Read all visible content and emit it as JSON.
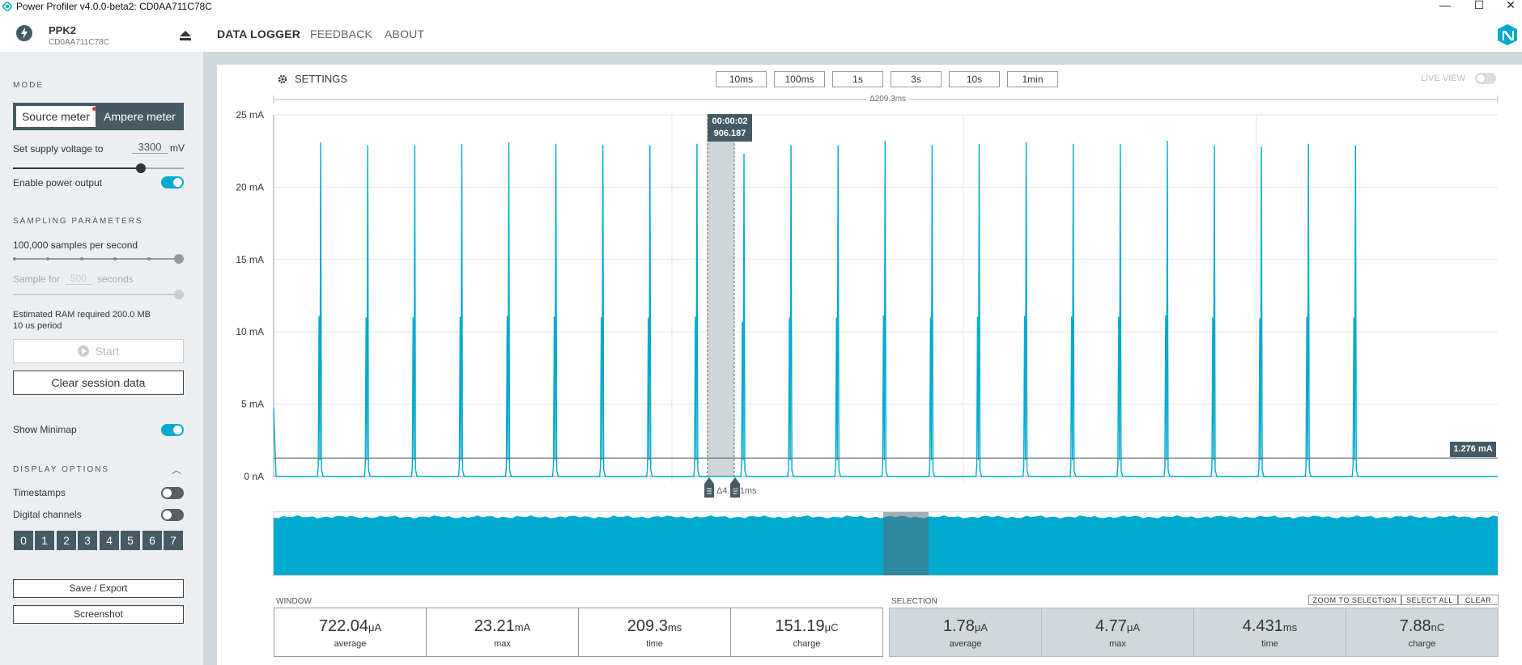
{
  "window": {
    "title": "Power Profiler v4.0.0-beta2: CD0AA711C78C"
  },
  "device": {
    "name": "PPK2",
    "serial": "CD0AA711C78C"
  },
  "nav": {
    "data_logger": "DATA LOGGER",
    "feedback": "FEEDBACK",
    "about": "ABOUT"
  },
  "sidebar": {
    "mode_title": "MODE",
    "source_meter": "Source meter",
    "ampere_meter": "Ampere meter",
    "supply_label": "Set supply voltage to",
    "supply_value": "3300",
    "supply_unit": "mV",
    "supply_level": 0.75,
    "enable_power": "Enable power output",
    "sampling_title": "SAMPLING PARAMETERS",
    "rate_label": "100,000 samples per second",
    "sample_for": "Sample for",
    "sample_value": "500",
    "seconds": "seconds",
    "ram": "Estimated RAM required 200.0 MB",
    "period": "10 us period",
    "start": "Start",
    "clear": "Clear session data",
    "minimap": "Show Minimap",
    "display_title": "DISPLAY OPTIONS",
    "timestamps": "Timestamps",
    "digital": "Digital channels",
    "channels": [
      "0",
      "1",
      "2",
      "3",
      "4",
      "5",
      "6",
      "7"
    ],
    "save": "Save / Export",
    "screenshot": "Screenshot"
  },
  "toolbar": {
    "settings": "SETTINGS",
    "windows": [
      "10ms",
      "100ms",
      "1s",
      "3s",
      "10s",
      "1min"
    ],
    "live_view": "LIVE VIEW",
    "delta": "Δ209.3ms"
  },
  "chart_data": {
    "type": "line",
    "ylabel_ticks": [
      "0 nA",
      "5 mA",
      "10 mA",
      "15 mA",
      "20 mA",
      "25 mA"
    ],
    "ylim": [
      0,
      25
    ],
    "y_unit": "mA",
    "series": [
      {
        "values": [
          4.7,
          23.1,
          22.9,
          22.9,
          23.0,
          23.1,
          23.0,
          22.9,
          22.9,
          23.0,
          22.3,
          22.9,
          22.9,
          23.2,
          22.9,
          23.0,
          23.1,
          23.0,
          23.0,
          23.2,
          22.9,
          22.8,
          23.0,
          22.9
        ]
      }
    ],
    "pulse_period_ms": 8.7,
    "average_line": 1.276,
    "average_label": "1.276 mA",
    "cursor_time": "00:00:02",
    "cursor_value": "906.187",
    "selection_delta": "Δ4.431ms"
  },
  "window_stats": {
    "title": "WINDOW",
    "items": [
      {
        "value": "722.04",
        "unit": "μA",
        "caption": "average"
      },
      {
        "value": "23.21",
        "unit": "mA",
        "caption": "max"
      },
      {
        "value": "209.3",
        "unit": "ms",
        "caption": "time"
      },
      {
        "value": "151.19",
        "unit": "μC",
        "caption": "charge"
      }
    ]
  },
  "selection_stats": {
    "title": "SELECTION",
    "zoom": "ZOOM TO SELECTION",
    "select_all": "SELECT ALL",
    "clear": "CLEAR",
    "items": [
      {
        "value": "1.78",
        "unit": "μA",
        "caption": "average"
      },
      {
        "value": "4.77",
        "unit": "μA",
        "caption": "max"
      },
      {
        "value": "4.431",
        "unit": "ms",
        "caption": "time"
      },
      {
        "value": "7.88",
        "unit": "nC",
        "caption": "charge"
      }
    ]
  },
  "colors": {
    "accent": "#00a9ce",
    "dark": "#455a64",
    "sidebar": "#eceff1",
    "bg": "#cfd8dc"
  }
}
